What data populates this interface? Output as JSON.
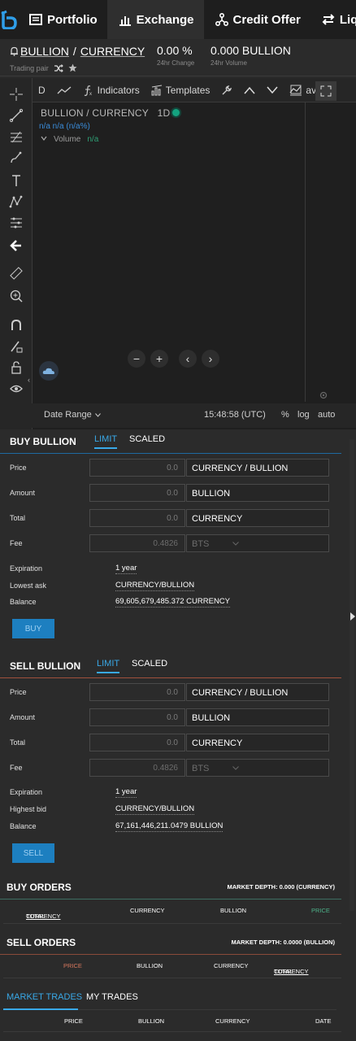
{
  "nav": {
    "tabs": [
      {
        "label": "Portfolio",
        "icon": "portfolio-icon"
      },
      {
        "label": "Exchange",
        "icon": "exchange-icon",
        "active": true
      },
      {
        "label": "Credit Offer",
        "icon": "credit-offer-icon"
      },
      {
        "label": "Liquidity",
        "icon": "liquidity-icon"
      }
    ]
  },
  "pair": {
    "base": "BULLION",
    "sep": "/",
    "quote": "CURRENCY",
    "sub_label": "Trading pair",
    "change_value": "0.00 %",
    "change_label": "24hr Change",
    "volume_value": "0.000 BULLION",
    "volume_label": "24hr Volume"
  },
  "chart": {
    "toolbar": {
      "interval": "D",
      "indicators": "Indicators",
      "templates": "Templates",
      "save": "ave"
    },
    "title": "BULLION / CURRENCY",
    "interval_label": "1D",
    "na_line": "n/a  n/a (n/a%)",
    "volume_label": "Volume",
    "volume_value": "n/a",
    "date_range": "Date Range",
    "time": "15:48:58 (UTC)",
    "percent": "%",
    "log": "log",
    "auto": "auto"
  },
  "buy": {
    "title": "BUY BULLION",
    "tab_limit": "LIMIT",
    "tab_scaled": "SCALED",
    "price_label": "Price",
    "price_value": "0.0",
    "price_unit": "CURRENCY / BULLION",
    "amount_label": "Amount",
    "amount_value": "0.0",
    "amount_unit": "BULLION",
    "total_label": "Total",
    "total_value": "0.0",
    "total_unit": "CURRENCY",
    "fee_label": "Fee",
    "fee_value": "0.4826",
    "fee_unit": "BTS",
    "expiration_label": "Expiration",
    "expiration_value": "1 year",
    "market_label": "Lowest ask",
    "market_value": "CURRENCY/BULLION",
    "balance_label": "Balance",
    "balance_value": "69,605,679,485.372 CURRENCY",
    "button": "BUY",
    "accent": "#39a9e8"
  },
  "sell": {
    "title": "SELL BULLION",
    "tab_limit": "LIMIT",
    "tab_scaled": "SCALED",
    "price_label": "Price",
    "price_value": "0.0",
    "price_unit": "CURRENCY / BULLION",
    "amount_label": "Amount",
    "amount_value": "0.0",
    "amount_unit": "BULLION",
    "total_label": "Total",
    "total_value": "0.0",
    "total_unit": "CURRENCY",
    "fee_label": "Fee",
    "fee_value": "0.4826",
    "fee_unit": "BTS",
    "expiration_label": "Expiration",
    "expiration_value": "1 year",
    "market_label": "Highest bid",
    "market_value": "CURRENCY/BULLION",
    "balance_label": "Balance",
    "balance_value": "67,161,446,211.0479 BULLION",
    "button": "SELL",
    "accent": "#c8553d"
  },
  "buy_orders": {
    "title": "BUY ORDERS",
    "depth": "MARKET DEPTH: 0.000 (CURRENCY)",
    "col_total_prefix": "TOTAL ",
    "col_total_unit": "CURRENCY",
    "col_currency": "CURRENCY",
    "col_bullion": "BULLION",
    "col_price": "PRICE",
    "price_color": "#4db38a"
  },
  "sell_orders": {
    "title": "SELL ORDERS",
    "depth": "MARKET DEPTH: 0.0000 (BULLION)",
    "col_price": "PRICE",
    "col_bullion": "BULLION",
    "col_currency": "CURRENCY",
    "col_total_prefix": "TOTAL ",
    "col_total_unit": "CURRENCY",
    "price_color": "#d8785e"
  },
  "trades": {
    "tab_market": "MARKET TRADES",
    "tab_my": "MY TRADES",
    "col_price": "PRICE",
    "col_bullion": "BULLION",
    "col_currency": "CURRENCY",
    "col_date": "DATE"
  }
}
